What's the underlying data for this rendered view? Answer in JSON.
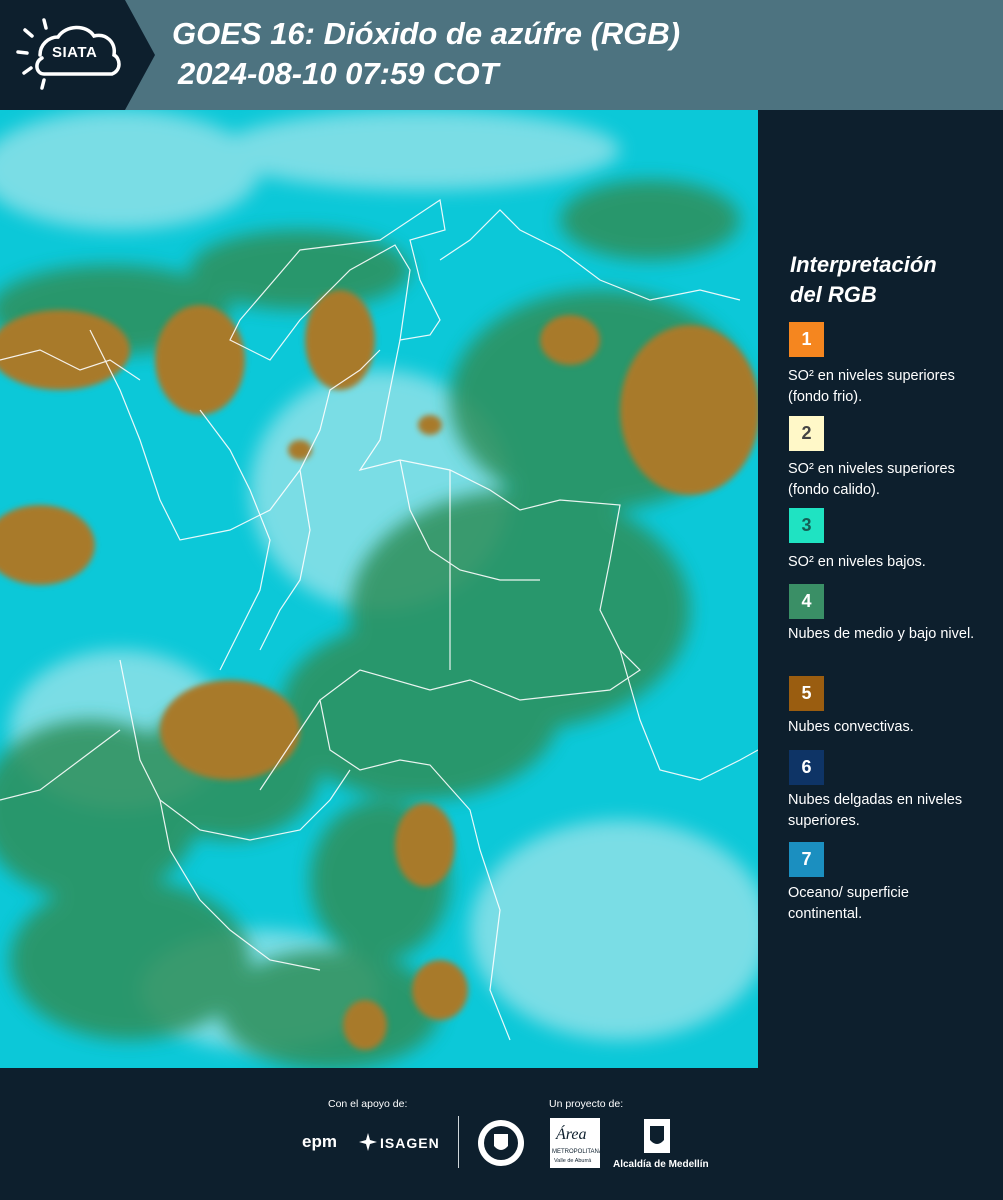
{
  "header": {
    "logo_text": "SIATA",
    "title": "GOES 16: Dióxido de azúfre (RGB)",
    "subtitle": "2024-08-10 07:59 COT"
  },
  "map": {
    "icon": "satellite-map",
    "colors": {
      "ocean": "#0cc8d8",
      "mid_clouds": "#2e8f5a",
      "convective": "#a87a2a",
      "borders": "#ffffff"
    }
  },
  "legend": {
    "title_line1": "Interpretación",
    "title_line2": "del RGB",
    "items": [
      {
        "number": "1",
        "color": "#f5861f",
        "text_color": "#ffffff",
        "label": "SO² en niveles superiores (fondo frio)."
      },
      {
        "number": "2",
        "color": "#fff8c8",
        "text_color": "#444444",
        "label": "SO² en niveles superiores (fondo calido)."
      },
      {
        "number": "3",
        "color": "#1fe3c2",
        "text_color": "#155f55",
        "label": "SO² en niveles bajos."
      },
      {
        "number": "4",
        "color": "#3a8f66",
        "text_color": "#ffffff",
        "label": "Nubes de medio y bajo nivel."
      },
      {
        "number": "5",
        "color": "#9a5d10",
        "text_color": "#ffffff",
        "label": "Nubes convectivas."
      },
      {
        "number": "6",
        "color": "#0e3466",
        "text_color": "#ffffff",
        "label": "Nubes delgadas en niveles superiores."
      },
      {
        "number": "7",
        "color": "#1b8fc0",
        "text_color": "#ffffff",
        "label": "Oceano/ superficie continental."
      }
    ]
  },
  "footer": {
    "support_label": "Con el apoyo de:",
    "project_label": "Un proyecto de:",
    "sponsor_epm": "epm",
    "sponsor_isagen": "ISAGEN",
    "area_text": "Área",
    "area_sub": "METROPOLITANA",
    "area_sub2": "Valle de Aburrá",
    "alcaldia": "Alcaldía de Medellín"
  }
}
